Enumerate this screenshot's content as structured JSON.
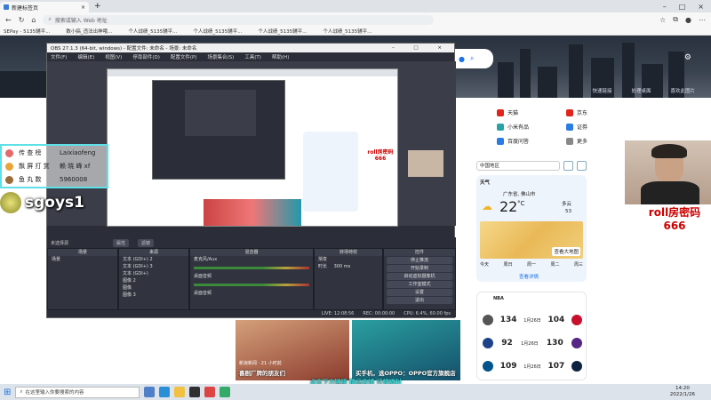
{
  "browser": {
    "tab_title": "新建标签页",
    "address_placeholder": "搜索或输入 Web 地址",
    "favorites": [
      "SEPay - 5135辅平...",
      "数小搞_违法出神哦...",
      "个人战绩_5135辅平...",
      "个人战绩_5135辅平...",
      "个人战绩_5135辅平...",
      "个人战绩_5135辅平..."
    ]
  },
  "banner": {
    "links": [
      "快速链接",
      "处理桌面",
      "喜欢此图片"
    ]
  },
  "quick_links": [
    {
      "label": "天猫",
      "color": "#e1251b"
    },
    {
      "label": "京东",
      "color": "#e1251b"
    },
    {
      "label": "小米有品",
      "color": "#27a3a5"
    },
    {
      "label": "证券",
      "color": "#2a7be4"
    },
    {
      "label": "百度问答",
      "color": "#2a7be4"
    },
    {
      "label": "更多",
      "color": "#888888"
    }
  ],
  "weather": {
    "location_select": "中国地区",
    "title": "天气",
    "location": "广东省, 佛山市",
    "temp": "22",
    "unit": "°C",
    "condition": "多云",
    "aqi": "53",
    "map_button": "查看大地图",
    "days": [
      "今天",
      "周日",
      "周一",
      "周二",
      "周三"
    ],
    "details": "查看详情"
  },
  "nba": {
    "title": "NBA",
    "games": [
      {
        "home": "134",
        "away": "104",
        "date": "1月26日"
      },
      {
        "home": "92",
        "away": "130",
        "date": "1月26日"
      },
      {
        "home": "109",
        "away": "107",
        "date": "1月26日"
      }
    ]
  },
  "news": [
    {
      "caption": "喜剧厂牌的朋友们",
      "source": "新浪新闻 · 21 小时前"
    },
    {
      "caption": "买手机，选OPPO：OPPO官方旗舰店"
    }
  ],
  "obs": {
    "title": "OBS 27.1.3 (64-bit, windows) - 配置文件: 未命名 - 场景: 未命名",
    "menu": [
      "文件(F)",
      "编辑(E)",
      "视图(V)",
      "停靠部件(D)",
      "配置文件(P)",
      "场景集合(S)",
      "工具(T)",
      "帮助(H)"
    ],
    "source_label": "未选择源",
    "prop_btn": "属性",
    "filter_btn": "滤镜",
    "scenes_header": "场景",
    "scenes": [
      "场景"
    ],
    "sources_header": "来源",
    "sources": [
      "文本 (GDI+) 2",
      "文本 (GDI+) 3",
      "文本 (GDI+)",
      "图像 2",
      "图像",
      "图像 3"
    ],
    "mixer_header": "混音器",
    "mixer_items": [
      "麦克风/Aux",
      "桌面音频",
      "桌面音频"
    ],
    "transitions_header": "转场特效",
    "transition": "渐变",
    "duration_label": "时长",
    "duration": "300 ms",
    "controls_header": "控件",
    "controls": [
      "停止推流",
      "开始录制",
      "启动虚拟摄像机",
      "工作室模式",
      "设置",
      "退出"
    ],
    "status": [
      "LIVE: 12:08:56",
      "REC: 00:00:00",
      "CPU: 6.4%, 60.00 fps"
    ]
  },
  "gift_overlay": {
    "rows": [
      {
        "label": "传 查 榜",
        "value": "Laixiaofeng"
      },
      {
        "label": "飘 屏 打 赏",
        "value": "赖 晓 峰 xf"
      },
      {
        "label": "鱼 丸 数",
        "value": "5960008"
      }
    ]
  },
  "streamer": {
    "name": "sgoys1",
    "cam_label_1": "roll房密码",
    "cam_label_2": "666",
    "small_label": "roll房密码\n666"
  },
  "subtitle": "点击下方链接 精品店铺 可领福利",
  "taskbar": {
    "search_placeholder": "在这里输入你要搜索的内容",
    "time": "14:20",
    "date": "2022/1/26"
  }
}
